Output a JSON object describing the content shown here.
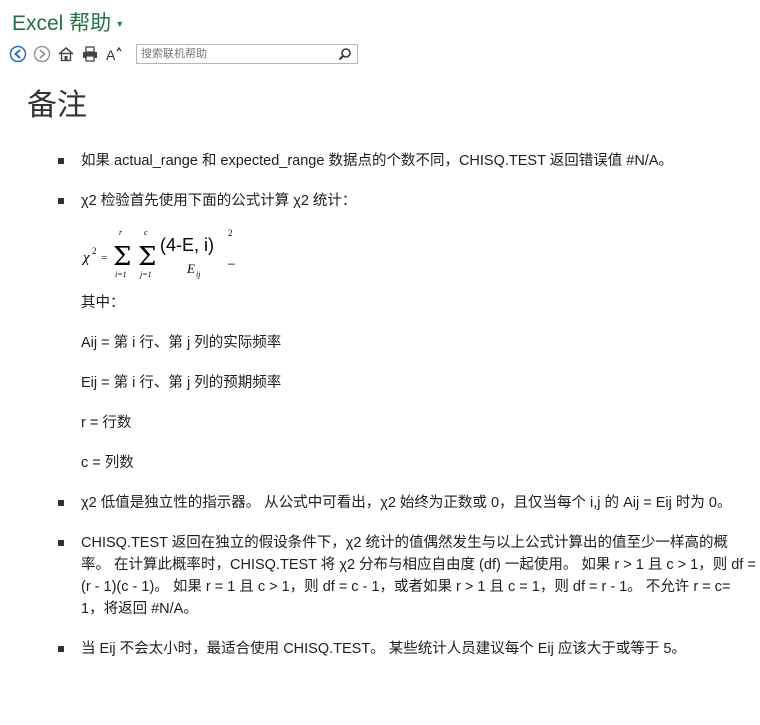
{
  "header": {
    "title": "Excel 帮助"
  },
  "toolbar": {
    "back": "back-arrow-icon",
    "forward": "forward-arrow-icon",
    "home": "home-icon",
    "print": "printer-icon",
    "font_size": "A",
    "search_placeholder": "搜索联机帮助"
  },
  "section": {
    "heading": "备注"
  },
  "bullets": [
    {
      "text": "如果 actual_range 和 expected_range 数据点的个数不同，CHISQ.TEST 返回错误值 #N/A。"
    },
    {
      "text": "χ2 检验首先使用下面的公式计算 χ2 统计：",
      "formula": {
        "lhs": "χ",
        "lhs_exp": "2",
        "eq": "=",
        "sum_upper_1": "r",
        "sum_lower_1": "i=1",
        "sum_upper_2": "c",
        "sum_lower_2": "j=1",
        "numerator": "(4-E, i)",
        "numerator_exp": "2",
        "denominator": "E",
        "denominator_sub": "ij",
        "trailing": "_"
      },
      "where": "其中：",
      "definitions": [
        "Aij = 第 i 行、第 j 列的实际频率",
        "Eij = 第 i 行、第 j 列的预期频率",
        "r = 行数",
        "c = 列数"
      ]
    },
    {
      "text": "χ2 低值是独立性的指示器。 从公式中可看出，χ2 始终为正数或 0，且仅当每个 i,j 的 Aij = Eij 时为 0。"
    },
    {
      "text": "CHISQ.TEST 返回在独立的假设条件下，χ2 统计的值偶然发生与以上公式计算出的值至少一样高的概率。 在计算此概率时，CHISQ.TEST 将 χ2 分布与相应自由度 (df) 一起使用。 如果 r > 1 且 c > 1，则 df = (r - 1)(c - 1)。 如果 r = 1 且 c > 1，则 df = c - 1，或者如果 r > 1 且 c = 1，则 df = r - 1。 不允许 r = c= 1，将返回 #N/A。"
    },
    {
      "text": "当 Eij 不会太小时，最适合使用 CHISQ.TEST。 某些统计人员建议每个 Eij 应该大于或等于 5。"
    }
  ]
}
